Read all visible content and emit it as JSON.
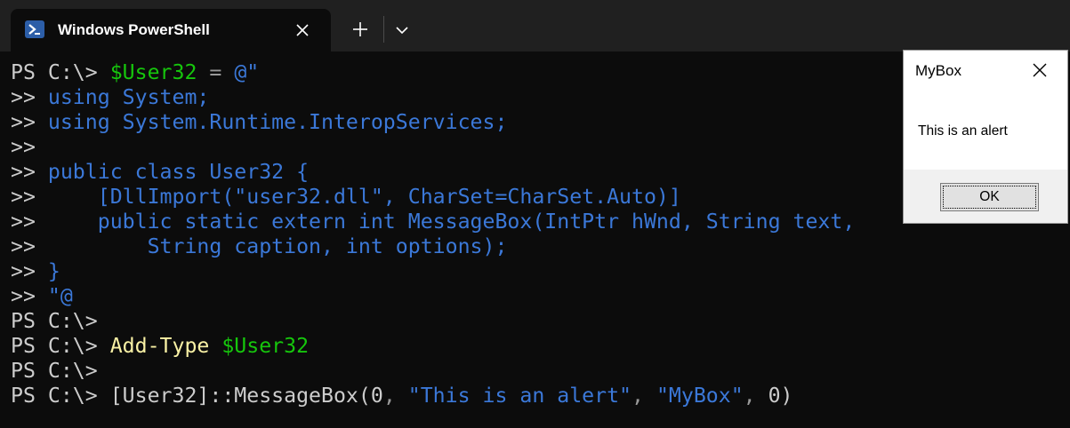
{
  "window": {
    "tab_title": "Windows PowerShell",
    "tab_icon": "powershell-icon",
    "close_icon": "close-icon",
    "new_tab_icon": "plus-icon",
    "dropdown_icon": "chevron-down-icon"
  },
  "terminal": {
    "colors": {
      "background": "#0c0c0c",
      "default": "#cccccc",
      "variable": "#16c60c",
      "string": "#3b78d8",
      "command": "#f9f1a5"
    },
    "lines": [
      {
        "segments": [
          {
            "text": "PS C:\\> ",
            "c": "default"
          },
          {
            "text": "$User32",
            "c": "var"
          },
          {
            "text": " = ",
            "c": "op"
          },
          {
            "text": "@\"",
            "c": "str"
          }
        ]
      },
      {
        "segments": [
          {
            "text": ">> ",
            "c": "default"
          },
          {
            "text": "using System;",
            "c": "str"
          }
        ]
      },
      {
        "segments": [
          {
            "text": ">> ",
            "c": "default"
          },
          {
            "text": "using System.Runtime.InteropServices;",
            "c": "str"
          }
        ]
      },
      {
        "segments": [
          {
            "text": ">>",
            "c": "default"
          }
        ]
      },
      {
        "segments": [
          {
            "text": ">> ",
            "c": "default"
          },
          {
            "text": "public class User32 {",
            "c": "str"
          }
        ]
      },
      {
        "segments": [
          {
            "text": ">> ",
            "c": "default"
          },
          {
            "text": "    [DllImport(\"user32.dll\", CharSet=CharSet.Auto)]",
            "c": "str"
          }
        ]
      },
      {
        "segments": [
          {
            "text": ">> ",
            "c": "default"
          },
          {
            "text": "    public static extern int MessageBox(IntPtr hWnd, String text,",
            "c": "str"
          }
        ]
      },
      {
        "segments": [
          {
            "text": ">> ",
            "c": "default"
          },
          {
            "text": "        String caption, int options);",
            "c": "str"
          }
        ]
      },
      {
        "segments": [
          {
            "text": ">> ",
            "c": "default"
          },
          {
            "text": "}",
            "c": "str"
          }
        ]
      },
      {
        "segments": [
          {
            "text": ">> ",
            "c": "default"
          },
          {
            "text": "\"@",
            "c": "str"
          }
        ]
      },
      {
        "segments": [
          {
            "text": "PS C:\\>",
            "c": "default"
          }
        ]
      },
      {
        "segments": [
          {
            "text": "PS C:\\> ",
            "c": "default"
          },
          {
            "text": "Add-Type",
            "c": "cmd"
          },
          {
            "text": " ",
            "c": "default"
          },
          {
            "text": "$User32",
            "c": "var"
          }
        ]
      },
      {
        "segments": [
          {
            "text": "PS C:\\>",
            "c": "default"
          }
        ]
      },
      {
        "segments": [
          {
            "text": "PS C:\\> ",
            "c": "default"
          },
          {
            "text": "[User32]::MessageBox(0",
            "c": "default"
          },
          {
            "text": ", ",
            "c": "op"
          },
          {
            "text": "\"This is an alert\"",
            "c": "str"
          },
          {
            "text": ", ",
            "c": "op"
          },
          {
            "text": "\"MyBox\"",
            "c": "str"
          },
          {
            "text": ", ",
            "c": "op"
          },
          {
            "text": "0)",
            "c": "default"
          }
        ]
      }
    ]
  },
  "dialog": {
    "title": "MyBox",
    "message": "This is an alert",
    "ok_label": "OK",
    "close_icon": "close-icon"
  }
}
